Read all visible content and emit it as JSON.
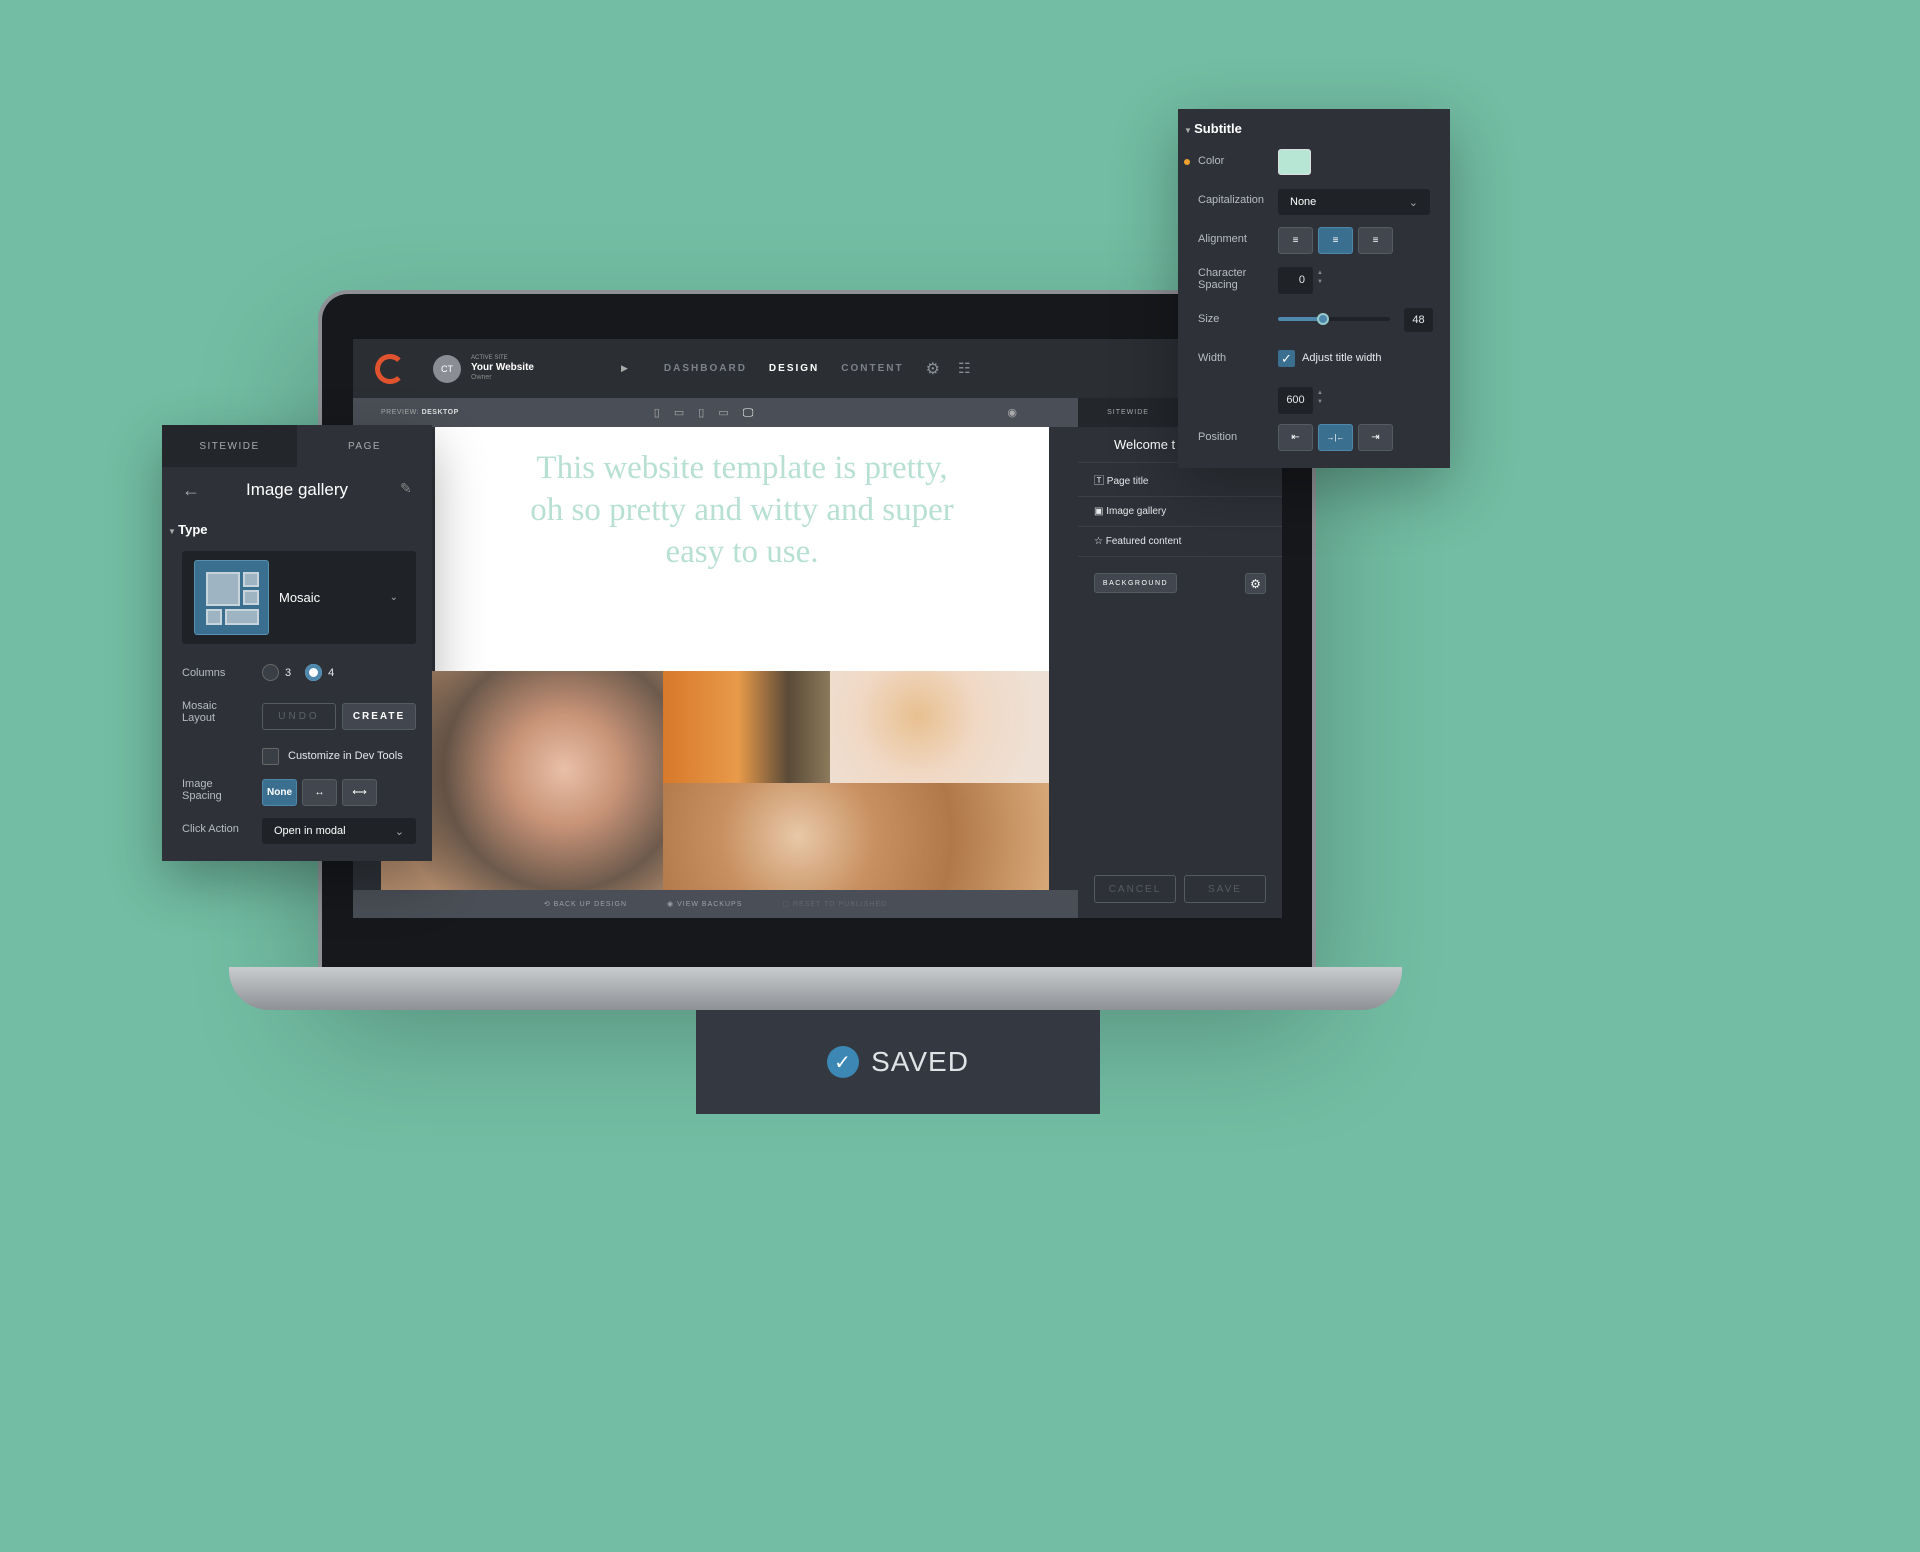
{
  "topbar": {
    "active_site_label": "ACTIVE SITE",
    "site_name": "Your Website",
    "role": "Owner",
    "avatar_initials": "CT",
    "nav": [
      "DASHBOARD",
      "DESIGN",
      "CONTENT"
    ],
    "active_nav": "DESIGN"
  },
  "preview": {
    "label": "PREVIEW:",
    "mode": "DESKTOP"
  },
  "canvas": {
    "headline": "This website template is pretty, oh so pretty and witty and super easy to use."
  },
  "bottombar": {
    "backup": "BACK UP DESIGN",
    "view": "VIEW BACKUPS",
    "reset": "RESET TO PUBLISHED"
  },
  "right_panel": {
    "tab": "SITEWIDE",
    "title": "Welcome t",
    "items": [
      "Page title",
      "Image gallery",
      "Featured content"
    ],
    "background": "BACKGROUND",
    "cancel": "CANCEL",
    "save": "SAVE"
  },
  "left_panel": {
    "tabs": [
      "SITEWIDE",
      "PAGE"
    ],
    "title": "Image gallery",
    "section": "Type",
    "type_value": "Mosaic",
    "columns_label": "Columns",
    "columns_options": [
      "3",
      "4"
    ],
    "columns_selected": "4",
    "mosaic_label": "Mosaic Layout",
    "undo": "UNDO",
    "create": "CREATE",
    "customize": "Customize in Dev Tools",
    "customize_checked": false,
    "spacing_label": "Image Spacing",
    "spacing_none": "None",
    "spacing_selected": "None",
    "click_label": "Click Action",
    "click_value": "Open in modal"
  },
  "popup": {
    "section": "Subtitle",
    "color_label": "Color",
    "color_value": "#b8e6d4",
    "cap_label": "Capitalization",
    "cap_value": "None",
    "align_label": "Alignment",
    "align_selected": "center",
    "spacing_label": "Character Spacing",
    "spacing_value": "0",
    "size_label": "Size",
    "size_value": "48",
    "size_fraction": 0.4,
    "width_label": "Width",
    "adjust_label": "Adjust title width",
    "adjust_checked": true,
    "width_value": "600",
    "position_label": "Position",
    "position_selected": "center"
  },
  "saved": {
    "label": "SAVED"
  },
  "colors": {
    "background": "#72bda3",
    "accent": "#3b6f8f",
    "logo": "#e0532e",
    "modified_dot": "#f0a030"
  }
}
